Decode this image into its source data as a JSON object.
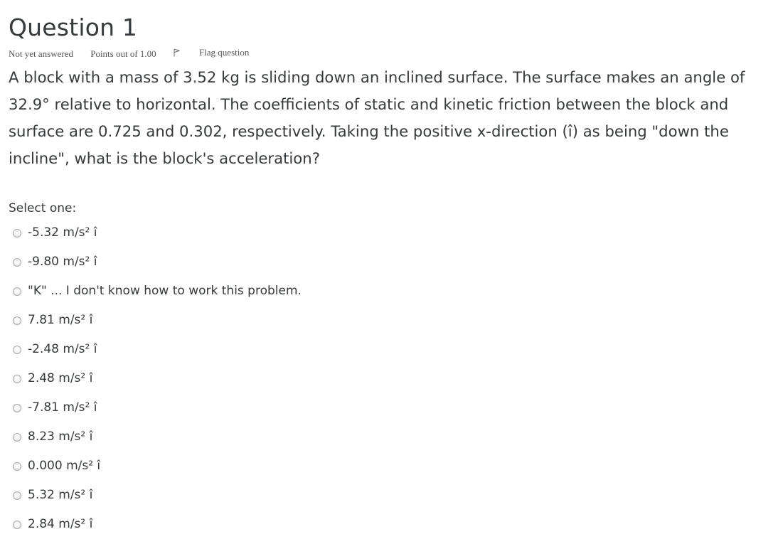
{
  "question": {
    "title": "Question 1",
    "status": "Not yet answered",
    "points": "Points out of 1.00",
    "flag_label": "Flag question",
    "flag_icon": "flag-icon",
    "text": "A block with a mass of 3.52 kg is sliding down an inclined surface. The surface makes an angle of 32.9° relative to horizontal. The coefficients of static and kinetic friction between the block and surface are 0.725 and 0.302, respectively. Taking the positive x-direction (î) as being \"down the incline\", what is the block's acceleration?"
  },
  "prompt": "Select one:",
  "answers": [
    {
      "label": "-5.32 m/s² î"
    },
    {
      "label": "-9.80 m/s² î"
    },
    {
      "label": "\"K\" ... I don't know how to work this problem."
    },
    {
      "label": "7.81 m/s² î"
    },
    {
      "label": "-2.48 m/s² î"
    },
    {
      "label": "2.48 m/s² î"
    },
    {
      "label": "-7.81 m/s² î"
    },
    {
      "label": "8.23 m/s² î"
    },
    {
      "label": "0.000 m/s² î"
    },
    {
      "label": "5.32 m/s² î"
    },
    {
      "label": "2.84 m/s² î"
    }
  ]
}
